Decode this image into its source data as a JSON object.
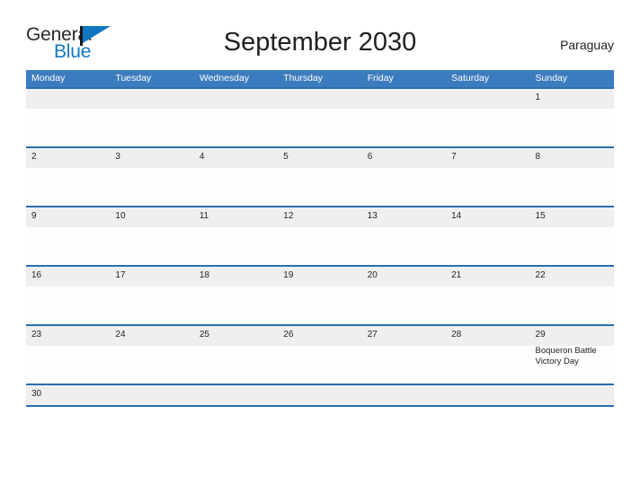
{
  "brand": {
    "name_part1": "General",
    "name_part2": "Blue",
    "colors": {
      "dark": "#27292b",
      "blue": "#1277c0"
    }
  },
  "header": {
    "title": "September 2030",
    "locale": "Paraguay"
  },
  "theme": {
    "header_blue": "#3c7cbe",
    "rule_blue": "#2a6ead",
    "band_gray": "#efefef",
    "page_background": "#ffffff",
    "text": "#231f20"
  },
  "calendar": {
    "month": "September",
    "year": "2030",
    "weekday_headers": [
      "Monday",
      "Tuesday",
      "Wednesday",
      "Thursday",
      "Friday",
      "Saturday",
      "Sunday"
    ],
    "weeks": [
      {
        "short": false,
        "days": [
          {
            "num": "",
            "empty": true,
            "events": []
          },
          {
            "num": "",
            "empty": true,
            "events": []
          },
          {
            "num": "",
            "empty": true,
            "events": []
          },
          {
            "num": "",
            "empty": true,
            "events": []
          },
          {
            "num": "",
            "empty": true,
            "events": []
          },
          {
            "num": "",
            "empty": true,
            "events": []
          },
          {
            "num": "1",
            "empty": false,
            "events": []
          }
        ]
      },
      {
        "short": false,
        "days": [
          {
            "num": "2",
            "empty": false,
            "events": []
          },
          {
            "num": "3",
            "empty": false,
            "events": []
          },
          {
            "num": "4",
            "empty": false,
            "events": []
          },
          {
            "num": "5",
            "empty": false,
            "events": []
          },
          {
            "num": "6",
            "empty": false,
            "events": []
          },
          {
            "num": "7",
            "empty": false,
            "events": []
          },
          {
            "num": "8",
            "empty": false,
            "events": []
          }
        ]
      },
      {
        "short": false,
        "days": [
          {
            "num": "9",
            "empty": false,
            "events": []
          },
          {
            "num": "10",
            "empty": false,
            "events": []
          },
          {
            "num": "11",
            "empty": false,
            "events": []
          },
          {
            "num": "12",
            "empty": false,
            "events": []
          },
          {
            "num": "13",
            "empty": false,
            "events": []
          },
          {
            "num": "14",
            "empty": false,
            "events": []
          },
          {
            "num": "15",
            "empty": false,
            "events": []
          }
        ]
      },
      {
        "short": false,
        "days": [
          {
            "num": "16",
            "empty": false,
            "events": []
          },
          {
            "num": "17",
            "empty": false,
            "events": []
          },
          {
            "num": "18",
            "empty": false,
            "events": []
          },
          {
            "num": "19",
            "empty": false,
            "events": []
          },
          {
            "num": "20",
            "empty": false,
            "events": []
          },
          {
            "num": "21",
            "empty": false,
            "events": []
          },
          {
            "num": "22",
            "empty": false,
            "events": []
          }
        ]
      },
      {
        "short": false,
        "days": [
          {
            "num": "23",
            "empty": false,
            "events": []
          },
          {
            "num": "24",
            "empty": false,
            "events": []
          },
          {
            "num": "25",
            "empty": false,
            "events": []
          },
          {
            "num": "26",
            "empty": false,
            "events": []
          },
          {
            "num": "27",
            "empty": false,
            "events": []
          },
          {
            "num": "28",
            "empty": false,
            "events": []
          },
          {
            "num": "29",
            "empty": false,
            "events": [
              "Boqueron Battle Victory Day"
            ]
          }
        ]
      },
      {
        "short": true,
        "days": [
          {
            "num": "30",
            "empty": false,
            "events": []
          },
          {
            "num": "",
            "empty": true,
            "events": []
          },
          {
            "num": "",
            "empty": true,
            "events": []
          },
          {
            "num": "",
            "empty": true,
            "events": []
          },
          {
            "num": "",
            "empty": true,
            "events": []
          },
          {
            "num": "",
            "empty": true,
            "events": []
          },
          {
            "num": "",
            "empty": true,
            "events": []
          }
        ]
      }
    ]
  }
}
